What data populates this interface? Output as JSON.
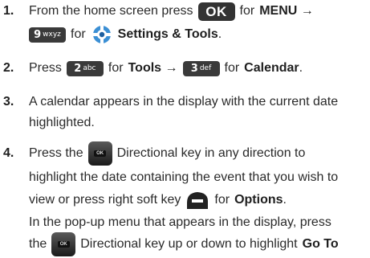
{
  "steps": [
    {
      "num": "1.",
      "l1_a": "From the home screen press",
      "l1_key": "OK",
      "l1_b": "for",
      "l1_bold": "MENU →",
      "l2_keydigit": "9",
      "l2_keyletters": "wxyz",
      "l2_a": "for",
      "l2_bold": "Settings & Tools",
      "l2_end": "."
    },
    {
      "num": "2.",
      "a": "Press",
      "key1_digit": "2",
      "key1_letters": "abc",
      "b": "for",
      "bold1": "Tools →",
      "key2_digit": "3",
      "key2_letters": "def",
      "c": "for",
      "bold2": "Calendar",
      "end": "."
    },
    {
      "num": "3.",
      "l1": "A calendar appears in the display with the current date",
      "l2": "highlighted."
    },
    {
      "num": "4.",
      "l1_a": "Press the",
      "dpad_label": "OK",
      "l1_b": "Directional key in any direction to",
      "l2": "highlight the date containing the event that you wish to",
      "l3_a": "view or press right soft key",
      "l3_b": "for",
      "l3_bold": "Options",
      "l3_end": ".",
      "l4": "In the pop-up menu that appears in the display, press",
      "l5_a": "the",
      "l5_b": "Directional key up or down to highlight",
      "l5_bold": "Go To"
    }
  ]
}
